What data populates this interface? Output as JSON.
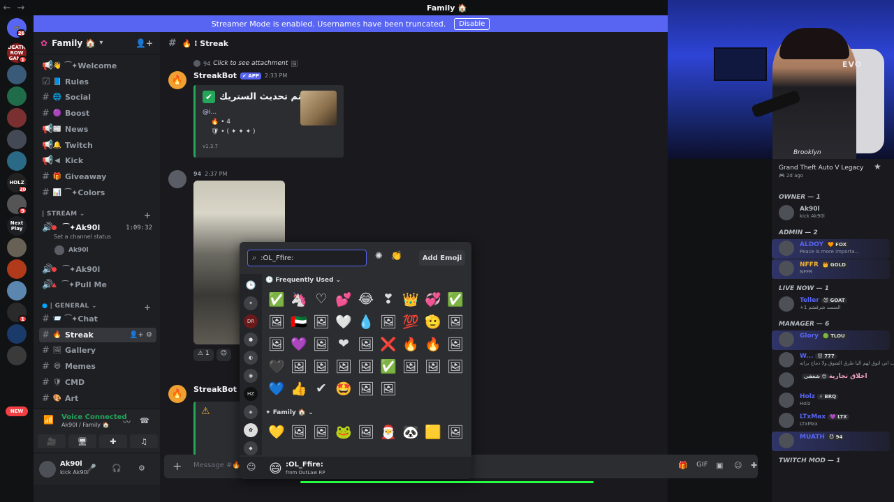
{
  "window": {
    "title": "Family 🏠"
  },
  "banner": {
    "text": "Streamer Mode is enabled. Usernames have been truncated.",
    "button": "Disable"
  },
  "servers": [
    {
      "label": "DEATH ROW GANG",
      "color": "#8a1c1c",
      "badge": "1"
    },
    {
      "label": "",
      "color": "#3a5a7a",
      "badge": ""
    },
    {
      "label": "",
      "color": "#1f6b4a",
      "badge": ""
    },
    {
      "label": "",
      "color": "#7a3030",
      "badge": ""
    },
    {
      "label": "",
      "color": "#444a55",
      "badge": ""
    },
    {
      "label": "",
      "color": "#2b6a86",
      "badge": ""
    },
    {
      "label": "HOLZ",
      "color": "#222",
      "badge": "20"
    },
    {
      "label": "",
      "color": "#555",
      "badge": "9"
    },
    {
      "label": "Next Play",
      "color": "#1e1f22",
      "badge": ""
    },
    {
      "label": "",
      "color": "#666055",
      "badge": ""
    },
    {
      "label": "",
      "color": "#b03a1a",
      "badge": ""
    },
    {
      "label": "",
      "color": "#5a86b0",
      "badge": ""
    },
    {
      "label": "",
      "color": "#2a2a2a",
      "badge": "1"
    },
    {
      "label": "",
      "color": "#1a3a6a",
      "badge": ""
    },
    {
      "label": "",
      "color": "#3a3a3a",
      "badge": ""
    }
  ],
  "server_top_badge": "26",
  "new_pill": "NEW",
  "guild": {
    "name": "Family 🏠"
  },
  "channels": [
    {
      "icon": "📢",
      "emoji": "👋",
      "name": "⁀✦Welcome"
    },
    {
      "icon": "☑",
      "emoji": "📘",
      "name": "Rules"
    },
    {
      "icon": "#",
      "emoji": "🌐",
      "name": "Social"
    },
    {
      "icon": "#",
      "emoji": "🟣",
      "name": "Boost"
    },
    {
      "icon": "📢",
      "emoji": "📰",
      "name": "News"
    },
    {
      "icon": "📢",
      "emoji": "🔔",
      "name": "Twitch"
    },
    {
      "icon": "📢",
      "emoji": "◀",
      "name": "Kick"
    },
    {
      "icon": "#",
      "emoji": "🎁",
      "name": "Giveaway"
    },
    {
      "icon": "#",
      "emoji": "📊",
      "name": "⁀✦Colors"
    }
  ],
  "stream_category": "| STREAM",
  "stream_channels": [
    {
      "name": "⁀✦Ak90l",
      "timer": "1:09:32",
      "status": "Set a channel status",
      "user": "Ak90l"
    },
    {
      "name": "⁀✦Ak90l"
    },
    {
      "name": "⁀✦Pull Me"
    }
  ],
  "general_category": "| GENERAL",
  "general_channels": [
    {
      "emoji": "📨",
      "name": "⁀✦Chat"
    },
    {
      "emoji": "🔥",
      "name": "Streak",
      "active": true
    },
    {
      "emoji": "🖼",
      "name": "Gallery"
    },
    {
      "emoji": "😄",
      "name": "Memes"
    },
    {
      "emoji": "🛡",
      "name": "CMD"
    },
    {
      "emoji": "🎨",
      "name": "Art"
    }
  ],
  "voice": {
    "title": "Voice Connected",
    "sub": "Ak90l / Family 🏠"
  },
  "user": {
    "name": "Ak90l",
    "status": "kick Ak90l"
  },
  "chat": {
    "channel": "🔥 ⁞ Streak",
    "reply1": {
      "num": "94",
      "text": "Click to see attachment"
    },
    "msg1": {
      "author": "StreakBot",
      "badge": "✔ APP",
      "time": "2:33 PM",
      "title": "تم تحديث الستريك •",
      "mention": "@i...",
      "line1": "🔥 • 4",
      "line2": "🛡 • ( ✦ ✦ ✦ )",
      "version": "v1.3.7"
    },
    "msg2": {
      "num": "94",
      "time": "2:37 PM"
    },
    "reactions": [
      "⚠ 1",
      "☺"
    ],
    "msg3": {
      "author": "StreakBot",
      "badge": "✔ A"
    },
    "composer_placeholder": "Message #🔥 ⁞"
  },
  "picker": {
    "search_value": ":OL_Ffire:",
    "add_label": "Add Emoji",
    "cat_frequent": "Frequently Used",
    "cat_family": "Family 🏠",
    "frequent": [
      "✅",
      "🦄",
      "♡",
      "💕",
      "😂",
      "❣",
      "👑",
      "💞",
      "✅",
      "🖼",
      "🇦🇪",
      "🖼",
      "🤍",
      "💧",
      "🖼",
      "💯",
      "🫡",
      "🖼",
      "🖼",
      "💜",
      "🖼",
      "❤",
      "🖼",
      "❌",
      "🔥",
      "🔥",
      "🖼",
      "🖤",
      "🖼",
      "🖼",
      "🖼",
      "🖼",
      "✅",
      "🖼",
      "🖼",
      "🖼",
      "💙",
      "👍",
      "✔",
      "🤩",
      "🖼",
      "🖼"
    ],
    "family": [
      "💛",
      "🖼",
      "🖼",
      "🐸",
      "🖼",
      "🎅",
      "🐼",
      "🟨",
      "🖼"
    ],
    "footer_emoji": "😄",
    "footer_name": ":OL_Ffire:",
    "footer_source": "from OutLaw RP"
  },
  "members": {
    "game": "Grand Theft Auto V Legacy",
    "game_sub": "🎮 2d ago",
    "roles": [
      {
        "label": "OWNER — 1",
        "members": [
          {
            "name": "Ak90l",
            "tag": "",
            "sub": "kick Ak90l",
            "color": "#b5bac1"
          }
        ]
      },
      {
        "label": "ADMIN — 2",
        "members": [
          {
            "name": "ALDOY",
            "tag": "🧡 FOX",
            "sub": "Peace is more importa...",
            "color": "#5865f2"
          },
          {
            "name": "NFFR",
            "tag": "👑 GOLD",
            "sub": "NFFR",
            "color": "#f0b232"
          }
        ]
      },
      {
        "label": "LIVE NOW — 1",
        "members": [
          {
            "name": "Teller",
            "tag": "😈 GOAT",
            "sub": "+1 المنصد شرقشم",
            "color": "#5865f2"
          }
        ]
      },
      {
        "label": "MANAGER — 6",
        "members": [
          {
            "name": "Glory",
            "tag": "🟢 TLOU",
            "sub": "",
            "color": "#5865f2"
          },
          {
            "name": "W...",
            "tag": "😈 777",
            "sub": "ب اني اتوق لهم اليا طرق الشوق ولا دماج براته",
            "color": "#5865f2"
          },
          {
            "name": "اخلاق تجارية",
            "tag": "😊 شغفي",
            "sub": "",
            "color": "#f0a0c0"
          },
          {
            "name": "Holz",
            "tag": "⚡ BRQ",
            "sub": "Holz",
            "color": "#5865f2"
          },
          {
            "name": "LTxMax",
            "tag": "💜 LTX",
            "sub": "LTxMax",
            "color": "#5865f2"
          },
          {
            "name": "MUATH",
            "tag": "😈 94",
            "sub": "",
            "color": "#5865f2"
          }
        ]
      },
      {
        "label": "TWITCH MOD — 1",
        "members": []
      }
    ]
  },
  "cam": {
    "brand": "EVO",
    "hood": "Brooklyn"
  }
}
